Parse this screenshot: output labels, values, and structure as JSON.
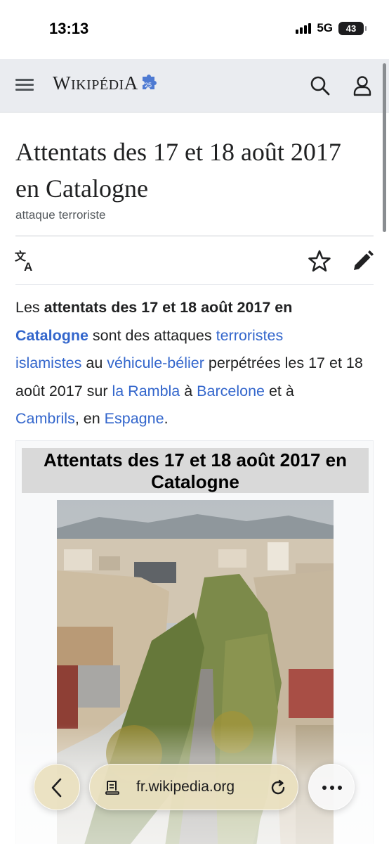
{
  "status_bar": {
    "time": "13:13",
    "network": "5G",
    "battery": "43"
  },
  "header": {
    "logo_text": "Wikipédia",
    "logo_badge": "25"
  },
  "article": {
    "title": "Attentats des 17 et 18 août 2017 en Catalogne",
    "subtitle": "attaque terroriste",
    "intro": {
      "t1": "Les ",
      "bold1": "attentats des 17 et 18 août 2017 en",
      "bold_link": "Catalogne",
      "t2": " sont des attaques ",
      "link_terroristes": "terroristes",
      "t3": " ",
      "link_islamistes": "islamistes",
      "t4": " au ",
      "link_vehicule": "véhicule-bélier",
      "t5": " perpétrées les 17 et 18 août 2017 sur ",
      "link_rambla": "la Rambla",
      "t6": " à ",
      "link_barcelone": "Barcelone",
      "t7": " et à ",
      "link_cambrils": "Cambrils",
      "t8": ", en ",
      "link_espagne": "Espagne",
      "t9": "."
    }
  },
  "infobox": {
    "title": "Attentats des 17 et 18 août 2017 en Catalogne"
  },
  "browser": {
    "url": "fr.wikipedia.org"
  },
  "colors": {
    "link": "#3366cc",
    "header_bg": "#eaecf0",
    "browser_pill": "#e9e0be"
  },
  "icons": {
    "menu": "menu-icon",
    "search": "search-icon",
    "user": "user-icon",
    "language": "language-icon",
    "watch": "star-icon",
    "edit": "pencil-icon",
    "back": "chevron-left-icon",
    "reader": "reader-icon",
    "reload": "reload-icon",
    "more": "more-icon"
  }
}
